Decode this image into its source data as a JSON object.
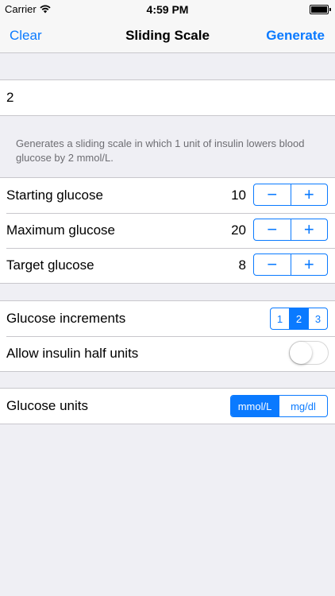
{
  "status_bar": {
    "carrier": "Carrier",
    "time": "4:59 PM",
    "wifi_icon": "wifi-icon",
    "battery_icon": "battery-icon"
  },
  "nav": {
    "left": "Clear",
    "title": "Sliding Scale",
    "right": "Generate"
  },
  "insulin_field": {
    "value": "2"
  },
  "description": "Generates a sliding scale in which 1 unit of insulin lowers blood glucose by 2 mmol/L.",
  "glucose_rows": [
    {
      "label": "Starting glucose",
      "value": "10",
      "minus": "−",
      "plus": "+"
    },
    {
      "label": "Maximum glucose",
      "value": "20",
      "minus": "−",
      "plus": "+"
    },
    {
      "label": "Target glucose",
      "value": "8",
      "minus": "−",
      "plus": "+"
    }
  ],
  "increments": {
    "label": "Glucose increments",
    "options": [
      "1",
      "2",
      "3"
    ],
    "selected": "2"
  },
  "half_units": {
    "label": "Allow insulin half units",
    "on": false
  },
  "units": {
    "label": "Glucose units",
    "options": [
      "mmol/L",
      "mg/dl"
    ],
    "selected": "mmol/L"
  },
  "colors": {
    "accent": "#0a7aff",
    "background": "#efeff4",
    "separator": "#c8c7cc"
  }
}
